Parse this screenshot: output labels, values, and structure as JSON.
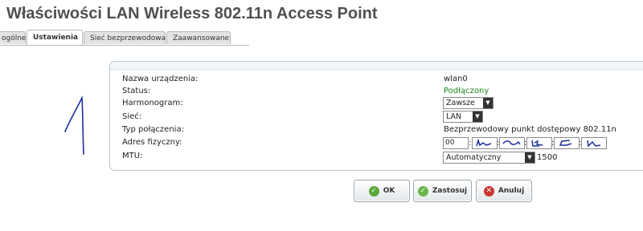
{
  "window": {
    "title": "Właściwości LAN Wireless 802.11n Access Point"
  },
  "tabs": [
    {
      "label": "ogólne"
    },
    {
      "label": "Ustawienia",
      "active": true
    },
    {
      "label": "Sieć bezprzewodowa"
    },
    {
      "label": "Zaawansowane"
    }
  ],
  "form": {
    "device_name": {
      "label": "Nazwa urządzenia:",
      "value": "wlan0"
    },
    "status": {
      "label": "Status:",
      "value": "Podłączony",
      "color": "#1a8a1a"
    },
    "schedule": {
      "label": "Harmonogram:",
      "value": "Zawsze"
    },
    "network": {
      "label": "Sieć:",
      "value": "LAN"
    },
    "connection_type": {
      "label": "Typ połączenia:",
      "value": "Bezprzewodowy punkt dostępowy 802.11n"
    },
    "mac": {
      "label": "Adres fizyczny:",
      "octet1": "00"
    },
    "mtu": {
      "label": "MTU:",
      "mode": "Automatyczny",
      "value": "1500"
    }
  },
  "buttons": {
    "ok": "OK",
    "apply": "Zastosuj",
    "cancel": "Anuluj"
  }
}
